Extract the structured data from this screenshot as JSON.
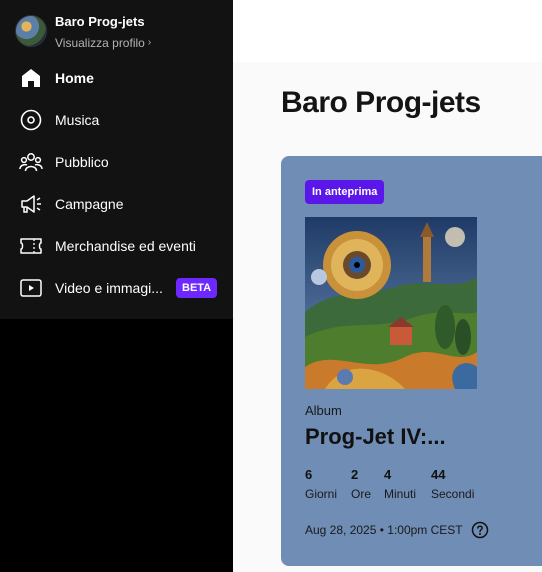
{
  "profile": {
    "name": "Baro Prog-jets",
    "link": "Visualizza profilo"
  },
  "nav": {
    "items": [
      {
        "label": "Home",
        "icon": "home-icon",
        "active": true
      },
      {
        "label": "Musica",
        "icon": "music-disc-icon"
      },
      {
        "label": "Pubblico",
        "icon": "audience-icon"
      },
      {
        "label": "Campagne",
        "icon": "megaphone-icon"
      },
      {
        "label": "Merchandise ed eventi",
        "icon": "ticket-icon"
      },
      {
        "label": "Video e immagi...",
        "icon": "video-icon",
        "badge": "BETA"
      }
    ]
  },
  "main": {
    "title": "Baro Prog-jets",
    "card": {
      "badge": "In anteprima",
      "type": "Album",
      "title": "Prog-Jet IV:...",
      "countdown": [
        {
          "value": "6",
          "unit": "Giorni"
        },
        {
          "value": "2",
          "unit": "Ore"
        },
        {
          "value": "4",
          "unit": "Minuti"
        },
        {
          "value": "44",
          "unit": "Secondi"
        }
      ],
      "release": "Aug 28, 2025 • 1:00pm CEST"
    }
  },
  "colors": {
    "sidebar_bg": "#121212",
    "beta_badge": "#6d28ff",
    "preview_badge": "#5b17ea",
    "card_bg": "#6f8db5"
  }
}
